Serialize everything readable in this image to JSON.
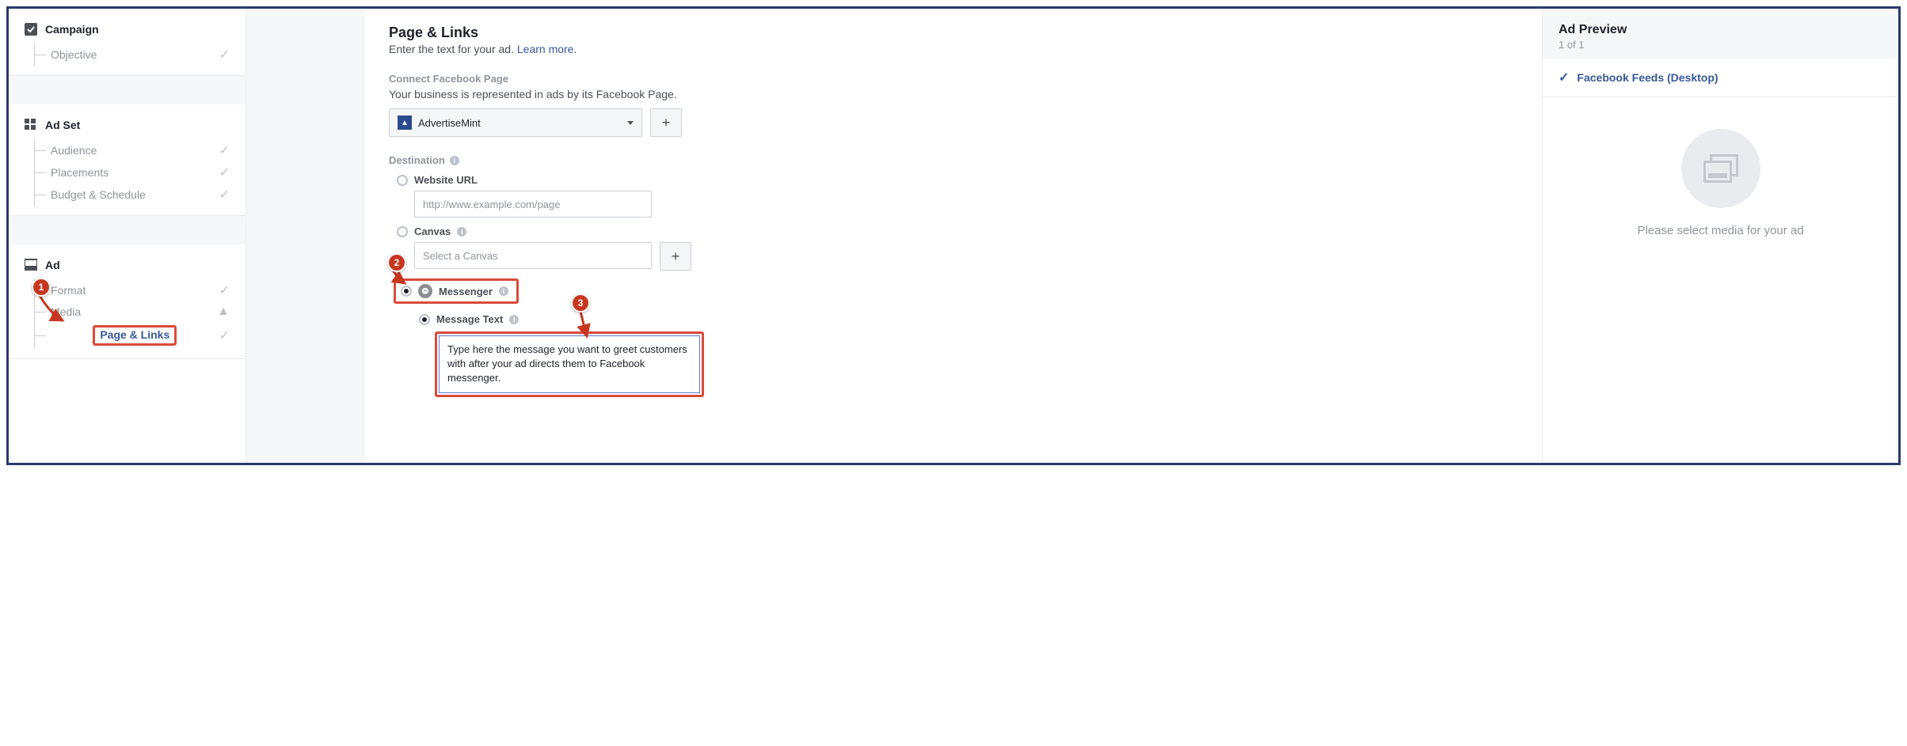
{
  "sidebar": {
    "campaign": {
      "label": "Campaign",
      "items": [
        "Objective"
      ]
    },
    "adset": {
      "label": "Ad Set",
      "items": [
        "Audience",
        "Placements",
        "Budget & Schedule"
      ]
    },
    "ad": {
      "label": "Ad",
      "items": [
        "Format",
        "Media",
        "Page & Links"
      ]
    }
  },
  "main": {
    "title": "Page & Links",
    "subtitle_text": "Enter the text for your ad. ",
    "subtitle_link": "Learn more",
    "connect_label": "Connect Facebook Page",
    "connect_help": "Your business is represented in ads by its Facebook Page.",
    "page_name": "AdvertiseMint",
    "destination_label": "Destination",
    "website_label": "Website URL",
    "website_placeholder": "http://www.example.com/page",
    "canvas_label": "Canvas",
    "canvas_placeholder": "Select a Canvas",
    "messenger_label": "Messenger",
    "message_text_label": "Message Text",
    "message_text_value": "Type here the message you want to greet customers with after your ad directs them to Facebook messenger."
  },
  "preview": {
    "title": "Ad Preview",
    "count": "1 of 1",
    "feed_name": "Facebook Feeds (Desktop)",
    "empty_msg": "Please select media for your ad"
  },
  "annotations": {
    "a1": "1",
    "a2": "2",
    "a3": "3"
  }
}
